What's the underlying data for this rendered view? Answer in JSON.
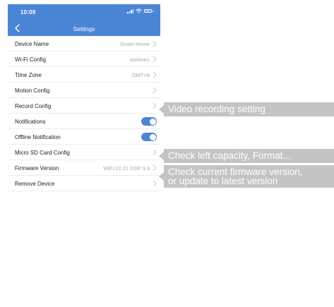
{
  "status_bar": {
    "time": "10:09"
  },
  "header": {
    "title": "Settings"
  },
  "settings": {
    "rows": [
      {
        "label": "Device Name",
        "value": "Smart Home",
        "control": "chevron"
      },
      {
        "label": "Wi-Fi Config",
        "value": "aishine1",
        "control": "chevron"
      },
      {
        "label": "Time Zone",
        "value": "GMT+8",
        "control": "chevron"
      },
      {
        "label": "Motion Config",
        "value": "",
        "control": "chevron"
      },
      {
        "label": "Record Config",
        "value": "",
        "control": "chevron"
      },
      {
        "label": "Notifications",
        "value": "",
        "control": "toggle",
        "on": true
      },
      {
        "label": "Offline Notification",
        "value": "",
        "control": "toggle",
        "on": true
      },
      {
        "label": "Micro SD Card Config",
        "value": "",
        "control": "chevron"
      },
      {
        "label": "Firmware Version",
        "value": "WiFi:22.21 DSP:3.9",
        "control": "chevron"
      },
      {
        "label": "Remove Device",
        "value": "",
        "control": "chevron"
      }
    ]
  },
  "callouts": {
    "record": "Video recording setting",
    "sdcard": "Check left capacity, Format...",
    "firmware_line1": "Check current firmware version,",
    "firmware_line2": "or update to latest version"
  },
  "colors": {
    "accent": "#4b86d6",
    "callout_bg": "#c4c4c4",
    "value_text": "#a8a8a8"
  },
  "icons": {
    "back": "chevron-left-icon",
    "row_action": "chevron-right-icon",
    "signal": "cellular-signal-icon",
    "wifi": "wifi-icon",
    "battery": "battery-icon"
  }
}
